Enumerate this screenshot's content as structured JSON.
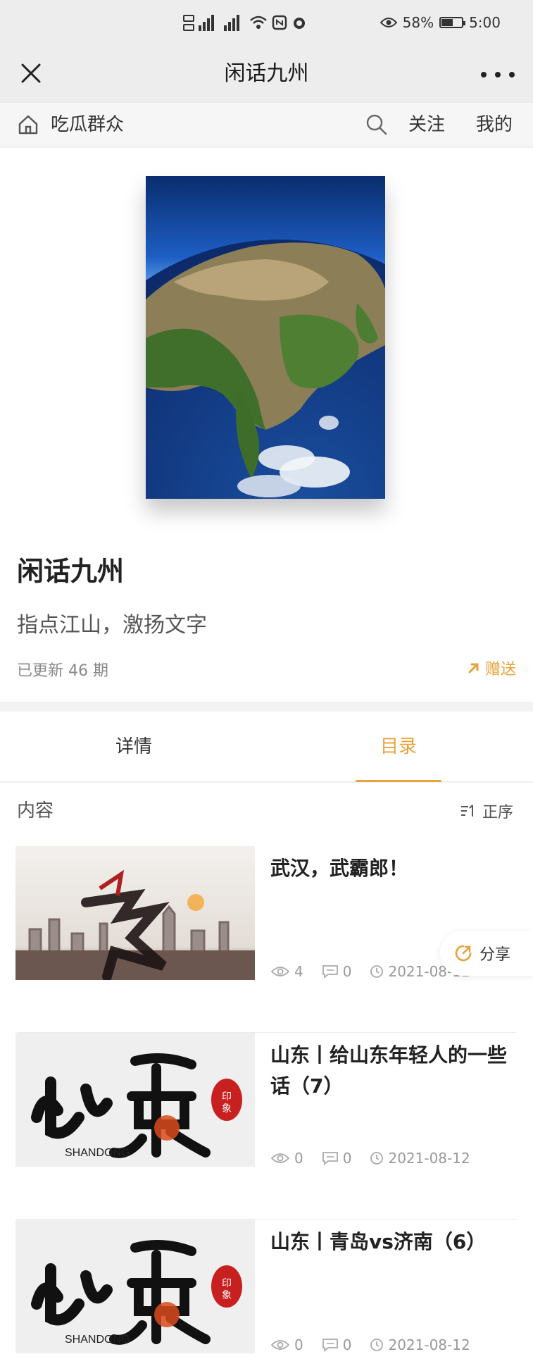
{
  "status_bar": {
    "battery_percent": "58%",
    "battery_level": 0.58,
    "time": "5:00"
  },
  "nav": {
    "title": "闲话九州",
    "close_icon": "close-icon",
    "more_icon": "more-icon"
  },
  "subnav": {
    "home_label": "吃瓜群众",
    "follow_label": "关注",
    "mine_label": "我的"
  },
  "magazine": {
    "title": "闲话九州",
    "description": "指点江山，激扬文字",
    "update_count": "已更新 46 期",
    "gift_label": "赠送"
  },
  "tabs": [
    {
      "label": "详情",
      "active": false
    },
    {
      "label": "目录",
      "active": true
    }
  ],
  "content": {
    "header": "内容",
    "sort_label": "正序",
    "share_label": "分享",
    "items": [
      {
        "title": "武汉，武霸郎！",
        "views": "4",
        "comments": "0",
        "date": "2021-08-12",
        "thumb": "wuhan"
      },
      {
        "title": "山东丨给山东年轻人的一些话（7）",
        "views": "0",
        "comments": "0",
        "date": "2021-08-12",
        "thumb": "shandong"
      },
      {
        "title": "山东丨青岛vs济南（6）",
        "views": "0",
        "comments": "0",
        "date": "2021-08-12",
        "thumb": "shandong"
      }
    ]
  },
  "colors": {
    "accent": "#e9a23b",
    "nav_bg": "#ededed",
    "text_primary": "#222222",
    "text_muted": "#999999"
  }
}
